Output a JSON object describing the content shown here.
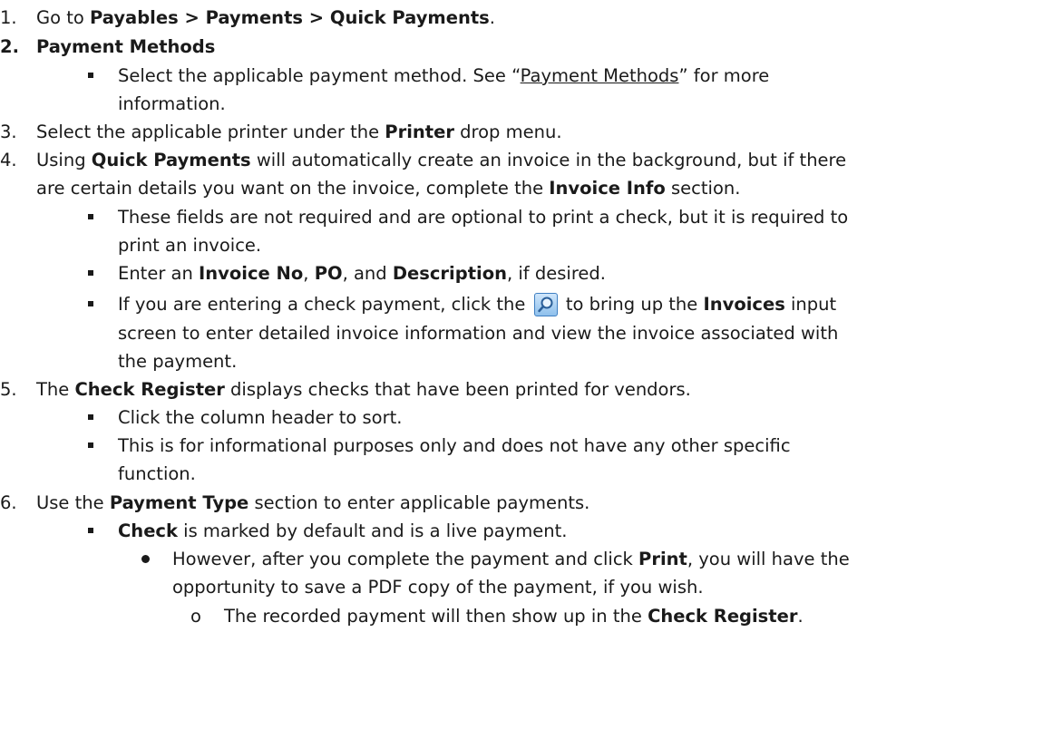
{
  "steps": {
    "s1": {
      "num": "1.",
      "pre": "Go to ",
      "bold": "Payables > Payments > Quick Payments",
      "post": "."
    },
    "s2": {
      "num": "2.",
      "title": "Payment Methods",
      "b1_pre": "Select the applicable payment method. See “",
      "b1_link": "Payment Methods",
      "b1_post": "” for more",
      "b1_cont": "information."
    },
    "s3": {
      "num": "3.",
      "pre": "Select the applicable printer under the ",
      "bold": "Printer",
      "post": " drop menu."
    },
    "s4": {
      "num": "4.",
      "pre": "Using ",
      "bold1": "Quick Payments",
      "mid": " will automatically create an invoice in the background, but if there",
      "cont_pre": "are certain details you want on the invoice, complete the ",
      "cont_bold": "Invoice Info",
      "cont_post": " section.",
      "b1_l1": "These fields are not required and are optional to print a check, but it is required to",
      "b1_l2": "print an invoice.",
      "b2_pre": "Enter an ",
      "b2_bold1": "Invoice No",
      "b2_sep1": ", ",
      "b2_bold2": "PO",
      "b2_sep2": ", and ",
      "b2_bold3": "Description",
      "b2_post": ", if desired.",
      "b3_pre": "If you are entering a check payment, click the ",
      "b3_mid": " to bring up the ",
      "b3_bold": "Invoices",
      "b3_post": " input",
      "b3_l2": "screen to enter detailed invoice information and view the invoice associated with",
      "b3_l3": "the payment."
    },
    "s5": {
      "num": "5.",
      "pre": "The ",
      "bold": "Check Register",
      "post": " displays checks that have been printed for vendors.",
      "b1": "Click the column header to sort.",
      "b2_l1": "This is for informational purposes only and does not have any other specific",
      "b2_l2": "function."
    },
    "s6": {
      "num": "6.",
      "pre": "Use the ",
      "bold": "Payment Type",
      "post": " section to enter applicable payments.",
      "b1_bold": "Check",
      "b1_post": " is marked by default and is a live payment.",
      "sub1_pre": "However, after you complete the payment and click ",
      "sub1_bold": "Print",
      "sub1_post": ", you will have the",
      "sub1_l2": "opportunity to save a PDF copy of the payment, if you wish.",
      "subsub_marker": "o",
      "subsub_pre": "The recorded payment will then show up in the ",
      "subsub_bold": "Check Register",
      "subsub_post": "."
    }
  },
  "icons": {
    "invoice_lookup": "magnifier-icon"
  }
}
